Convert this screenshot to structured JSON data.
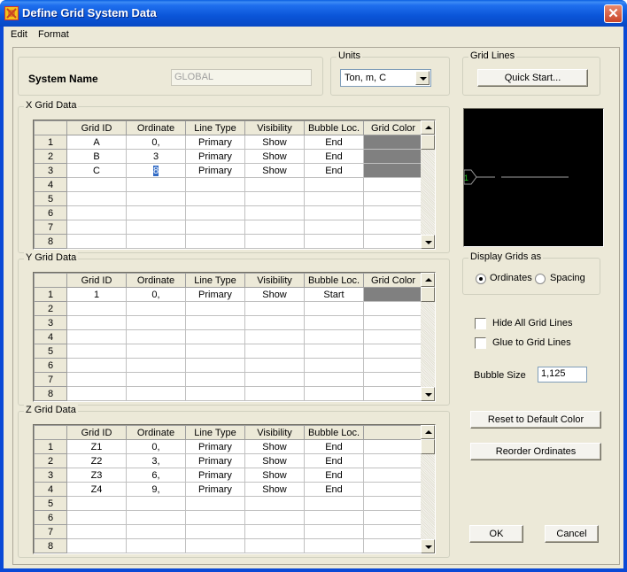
{
  "window": {
    "title": "Define Grid System Data",
    "close_icon": "close-icon"
  },
  "menu": [
    "Edit",
    "Format"
  ],
  "system": {
    "label": "System Name",
    "value": "GLOBAL"
  },
  "units": {
    "group_label": "Units",
    "selected": "Ton, m, C"
  },
  "grid_lines": {
    "group_label": "Grid Lines",
    "quick_start_label": "Quick Start..."
  },
  "columns": [
    "Grid ID",
    "Ordinate",
    "Line Type",
    "Visibility",
    "Bubble Loc.",
    "Grid Color"
  ],
  "z_columns": [
    "Grid ID",
    "Ordinate",
    "Line Type",
    "Visibility",
    "Bubble Loc.",
    ""
  ],
  "x_grid": {
    "label": "X Grid Data",
    "rows": [
      {
        "n": "1",
        "id": "A",
        "ord": "0,",
        "type": "Primary",
        "vis": "Show",
        "bubble": "End",
        "color": "#808080"
      },
      {
        "n": "2",
        "id": "B",
        "ord": "3",
        "type": "Primary",
        "vis": "Show",
        "bubble": "End",
        "color": "#808080"
      },
      {
        "n": "3",
        "id": "C",
        "ord": "8",
        "type": "Primary",
        "vis": "Show",
        "bubble": "End",
        "color": "#808080"
      },
      {
        "n": "4",
        "id": "",
        "ord": "",
        "type": "",
        "vis": "",
        "bubble": "",
        "color": ""
      },
      {
        "n": "5",
        "id": "",
        "ord": "",
        "type": "",
        "vis": "",
        "bubble": "",
        "color": ""
      },
      {
        "n": "6",
        "id": "",
        "ord": "",
        "type": "",
        "vis": "",
        "bubble": "",
        "color": ""
      },
      {
        "n": "7",
        "id": "",
        "ord": "",
        "type": "",
        "vis": "",
        "bubble": "",
        "color": ""
      },
      {
        "n": "8",
        "id": "",
        "ord": "",
        "type": "",
        "vis": "",
        "bubble": "",
        "color": ""
      }
    ]
  },
  "y_grid": {
    "label": "Y Grid Data",
    "rows": [
      {
        "n": "1",
        "id": "1",
        "ord": "0,",
        "type": "Primary",
        "vis": "Show",
        "bubble": "Start",
        "color": "#808080"
      },
      {
        "n": "2",
        "id": "",
        "ord": "",
        "type": "",
        "vis": "",
        "bubble": "",
        "color": ""
      },
      {
        "n": "3",
        "id": "",
        "ord": "",
        "type": "",
        "vis": "",
        "bubble": "",
        "color": ""
      },
      {
        "n": "4",
        "id": "",
        "ord": "",
        "type": "",
        "vis": "",
        "bubble": "",
        "color": ""
      },
      {
        "n": "5",
        "id": "",
        "ord": "",
        "type": "",
        "vis": "",
        "bubble": "",
        "color": ""
      },
      {
        "n": "6",
        "id": "",
        "ord": "",
        "type": "",
        "vis": "",
        "bubble": "",
        "color": ""
      },
      {
        "n": "7",
        "id": "",
        "ord": "",
        "type": "",
        "vis": "",
        "bubble": "",
        "color": ""
      },
      {
        "n": "8",
        "id": "",
        "ord": "",
        "type": "",
        "vis": "",
        "bubble": "",
        "color": ""
      }
    ]
  },
  "z_grid": {
    "label": "Z Grid Data",
    "rows": [
      {
        "n": "1",
        "id": "Z1",
        "ord": "0,",
        "type": "Primary",
        "vis": "Show",
        "bubble": "End",
        "color": ""
      },
      {
        "n": "2",
        "id": "Z2",
        "ord": "3,",
        "type": "Primary",
        "vis": "Show",
        "bubble": "End",
        "color": ""
      },
      {
        "n": "3",
        "id": "Z3",
        "ord": "6,",
        "type": "Primary",
        "vis": "Show",
        "bubble": "End",
        "color": ""
      },
      {
        "n": "4",
        "id": "Z4",
        "ord": "9,",
        "type": "Primary",
        "vis": "Show",
        "bubble": "End",
        "color": ""
      },
      {
        "n": "5",
        "id": "",
        "ord": "",
        "type": "",
        "vis": "",
        "bubble": "",
        "color": ""
      },
      {
        "n": "6",
        "id": "",
        "ord": "",
        "type": "",
        "vis": "",
        "bubble": "",
        "color": ""
      },
      {
        "n": "7",
        "id": "",
        "ord": "",
        "type": "",
        "vis": "",
        "bubble": "",
        "color": ""
      },
      {
        "n": "8",
        "id": "",
        "ord": "",
        "type": "",
        "vis": "",
        "bubble": "",
        "color": ""
      }
    ]
  },
  "preview": {
    "bubble_label": "1",
    "bubble_color": "#22cc22",
    "line_color": "#a0a0a0"
  },
  "display_grids": {
    "label": "Display Grids as",
    "options": [
      "Ordinates",
      "Spacing"
    ],
    "selected": "Ordinates"
  },
  "options": {
    "hide_all_label": "Hide All Grid Lines",
    "hide_all_checked": false,
    "glue_label": "Glue to Grid Lines",
    "glue_checked": false
  },
  "bubble_size": {
    "label": "Bubble Size",
    "value": "1,125"
  },
  "buttons": {
    "reset_color": "Reset to Default Color",
    "reorder": "Reorder Ordinates",
    "ok": "OK",
    "cancel": "Cancel"
  }
}
